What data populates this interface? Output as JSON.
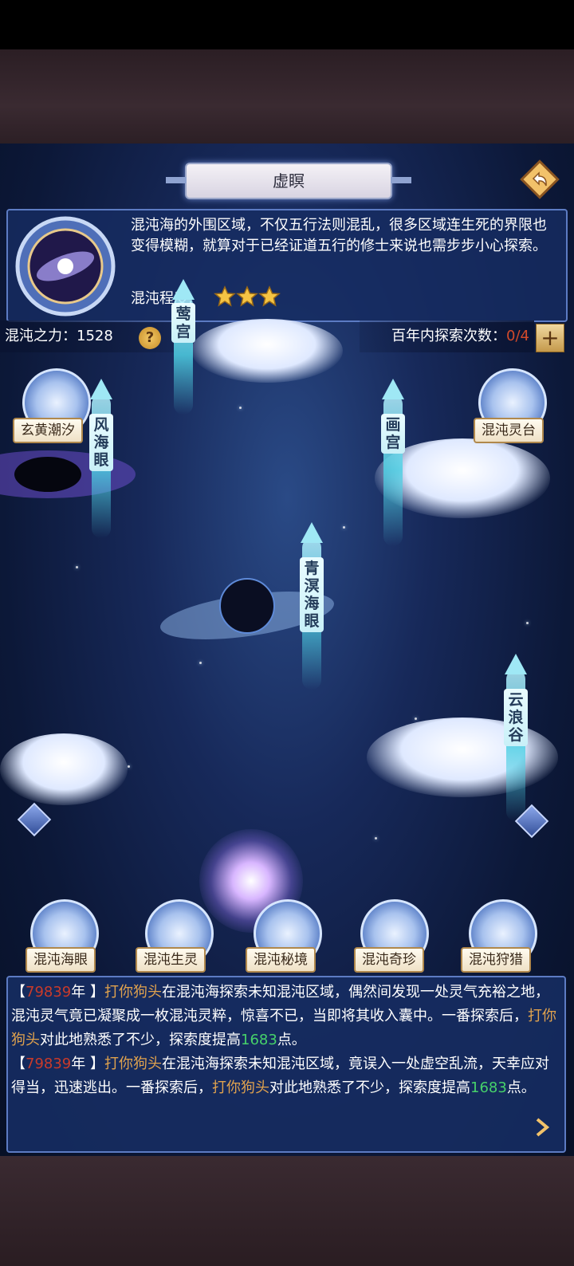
{
  "header": {
    "title": "虚瞑"
  },
  "info": {
    "description": "混沌海的外围区域，不仅五行法则混乱，很多区域连生死的界限也变得模糊，就算对于已经证道五行的修士来说也需步步小心探索。",
    "chaos_level_label": "混沌程度:",
    "chaos_level_stars": 3
  },
  "stats": {
    "power_label": "混沌之力：",
    "power_value": "1528",
    "help": "?",
    "explore_label": "百年内探索次数：",
    "explore_count": "0/4",
    "add": "+"
  },
  "map": {
    "nodes": {
      "yinggong": "莺宫",
      "xuanhuang": "玄黄潮汐",
      "feng": "风海眼",
      "huagong": "画宫",
      "lingtai": "混沌灵台",
      "qingming": "青溟海眼",
      "yunlanggu": "云浪谷"
    }
  },
  "bottom_menu": [
    "混沌海眼",
    "混沌生灵",
    "混沌秘境",
    "混沌奇珍",
    "混沌狩猎"
  ],
  "log": [
    {
      "open": "【",
      "year": "79839",
      "year_suffix": "年 】",
      "name": "打你狗头",
      "text1": "在混沌海探索未知混沌区域，偶然间发现一处灵气充裕之地，混沌灵气竟已凝聚成一枚混沌灵粹，惊喜不已，当即将其收入囊中。一番探索后，",
      "name2": "打你狗头",
      "text2": "对此地熟悉了不少，探索度提高",
      "gain": "1683",
      "unit": "点。"
    },
    {
      "open": "【",
      "year": "79839",
      "year_suffix": "年 】",
      "name": "打你狗头",
      "text1": "在混沌海探索未知混沌区域，竟误入一处虚空乱流，天幸应对得当，迅速逃出。一番探索后，",
      "name2": "打你狗头",
      "text2": "对此地熟悉了不少，探索度提高",
      "gain": "1683",
      "unit": "点。"
    }
  ],
  "colors": {
    "accent": "#5c7bc3",
    "year": "#c93a2a",
    "name": "#e0a24e",
    "gain": "#46d16a"
  }
}
